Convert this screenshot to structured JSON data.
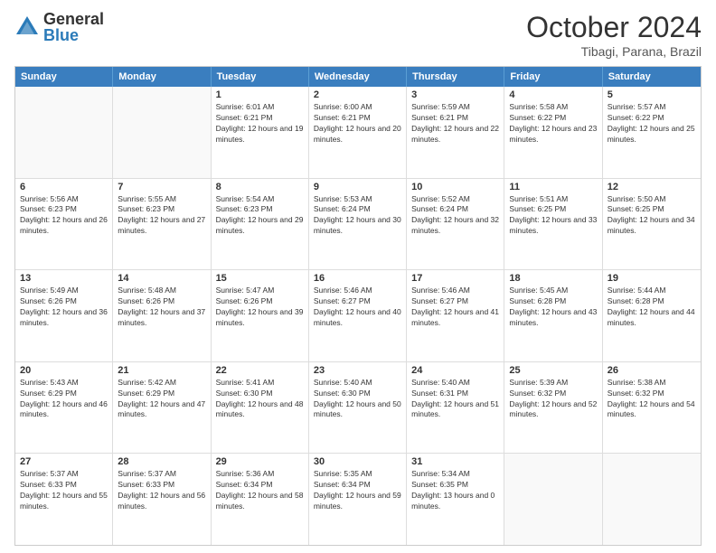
{
  "logo": {
    "general": "General",
    "blue": "Blue"
  },
  "title": {
    "month": "October 2024",
    "location": "Tibagi, Parana, Brazil"
  },
  "header_days": [
    "Sunday",
    "Monday",
    "Tuesday",
    "Wednesday",
    "Thursday",
    "Friday",
    "Saturday"
  ],
  "weeks": [
    [
      {
        "day": "",
        "info": ""
      },
      {
        "day": "",
        "info": ""
      },
      {
        "day": "1",
        "info": "Sunrise: 6:01 AM\nSunset: 6:21 PM\nDaylight: 12 hours and 19 minutes."
      },
      {
        "day": "2",
        "info": "Sunrise: 6:00 AM\nSunset: 6:21 PM\nDaylight: 12 hours and 20 minutes."
      },
      {
        "day": "3",
        "info": "Sunrise: 5:59 AM\nSunset: 6:21 PM\nDaylight: 12 hours and 22 minutes."
      },
      {
        "day": "4",
        "info": "Sunrise: 5:58 AM\nSunset: 6:22 PM\nDaylight: 12 hours and 23 minutes."
      },
      {
        "day": "5",
        "info": "Sunrise: 5:57 AM\nSunset: 6:22 PM\nDaylight: 12 hours and 25 minutes."
      }
    ],
    [
      {
        "day": "6",
        "info": "Sunrise: 5:56 AM\nSunset: 6:23 PM\nDaylight: 12 hours and 26 minutes."
      },
      {
        "day": "7",
        "info": "Sunrise: 5:55 AM\nSunset: 6:23 PM\nDaylight: 12 hours and 27 minutes."
      },
      {
        "day": "8",
        "info": "Sunrise: 5:54 AM\nSunset: 6:23 PM\nDaylight: 12 hours and 29 minutes."
      },
      {
        "day": "9",
        "info": "Sunrise: 5:53 AM\nSunset: 6:24 PM\nDaylight: 12 hours and 30 minutes."
      },
      {
        "day": "10",
        "info": "Sunrise: 5:52 AM\nSunset: 6:24 PM\nDaylight: 12 hours and 32 minutes."
      },
      {
        "day": "11",
        "info": "Sunrise: 5:51 AM\nSunset: 6:25 PM\nDaylight: 12 hours and 33 minutes."
      },
      {
        "day": "12",
        "info": "Sunrise: 5:50 AM\nSunset: 6:25 PM\nDaylight: 12 hours and 34 minutes."
      }
    ],
    [
      {
        "day": "13",
        "info": "Sunrise: 5:49 AM\nSunset: 6:26 PM\nDaylight: 12 hours and 36 minutes."
      },
      {
        "day": "14",
        "info": "Sunrise: 5:48 AM\nSunset: 6:26 PM\nDaylight: 12 hours and 37 minutes."
      },
      {
        "day": "15",
        "info": "Sunrise: 5:47 AM\nSunset: 6:26 PM\nDaylight: 12 hours and 39 minutes."
      },
      {
        "day": "16",
        "info": "Sunrise: 5:46 AM\nSunset: 6:27 PM\nDaylight: 12 hours and 40 minutes."
      },
      {
        "day": "17",
        "info": "Sunrise: 5:46 AM\nSunset: 6:27 PM\nDaylight: 12 hours and 41 minutes."
      },
      {
        "day": "18",
        "info": "Sunrise: 5:45 AM\nSunset: 6:28 PM\nDaylight: 12 hours and 43 minutes."
      },
      {
        "day": "19",
        "info": "Sunrise: 5:44 AM\nSunset: 6:28 PM\nDaylight: 12 hours and 44 minutes."
      }
    ],
    [
      {
        "day": "20",
        "info": "Sunrise: 5:43 AM\nSunset: 6:29 PM\nDaylight: 12 hours and 46 minutes."
      },
      {
        "day": "21",
        "info": "Sunrise: 5:42 AM\nSunset: 6:29 PM\nDaylight: 12 hours and 47 minutes."
      },
      {
        "day": "22",
        "info": "Sunrise: 5:41 AM\nSunset: 6:30 PM\nDaylight: 12 hours and 48 minutes."
      },
      {
        "day": "23",
        "info": "Sunrise: 5:40 AM\nSunset: 6:30 PM\nDaylight: 12 hours and 50 minutes."
      },
      {
        "day": "24",
        "info": "Sunrise: 5:40 AM\nSunset: 6:31 PM\nDaylight: 12 hours and 51 minutes."
      },
      {
        "day": "25",
        "info": "Sunrise: 5:39 AM\nSunset: 6:32 PM\nDaylight: 12 hours and 52 minutes."
      },
      {
        "day": "26",
        "info": "Sunrise: 5:38 AM\nSunset: 6:32 PM\nDaylight: 12 hours and 54 minutes."
      }
    ],
    [
      {
        "day": "27",
        "info": "Sunrise: 5:37 AM\nSunset: 6:33 PM\nDaylight: 12 hours and 55 minutes."
      },
      {
        "day": "28",
        "info": "Sunrise: 5:37 AM\nSunset: 6:33 PM\nDaylight: 12 hours and 56 minutes."
      },
      {
        "day": "29",
        "info": "Sunrise: 5:36 AM\nSunset: 6:34 PM\nDaylight: 12 hours and 58 minutes."
      },
      {
        "day": "30",
        "info": "Sunrise: 5:35 AM\nSunset: 6:34 PM\nDaylight: 12 hours and 59 minutes."
      },
      {
        "day": "31",
        "info": "Sunrise: 5:34 AM\nSunset: 6:35 PM\nDaylight: 13 hours and 0 minutes."
      },
      {
        "day": "",
        "info": ""
      },
      {
        "day": "",
        "info": ""
      }
    ]
  ]
}
